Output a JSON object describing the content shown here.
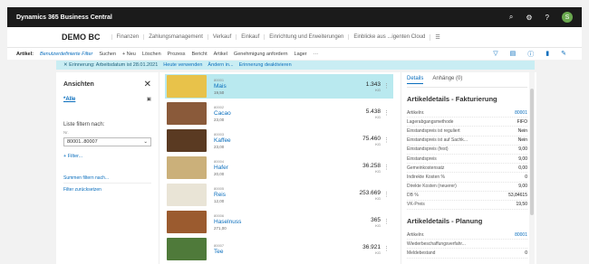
{
  "app": {
    "title": "Dynamics 365 Business Central",
    "icons": [
      "search-icon",
      "gear-icon",
      "help-icon"
    ],
    "avatar_initial": "S"
  },
  "nav": {
    "company": "DEMO BC",
    "items": [
      "Finanzen",
      "Zahlungsmanagement",
      "Verkauf",
      "Einkauf",
      "Einrichtung und Erweiterungen",
      "Einblicke aus ...igenten Cloud"
    ]
  },
  "actions": {
    "label": "Artikel:",
    "filter": "Benutzerdefinierte Filter",
    "items": [
      "Suchen",
      "+ Neu",
      "Löschen",
      "Prozess",
      "Bericht",
      "Artikel",
      "Genehmigung anfordern",
      "Lager",
      "···"
    ]
  },
  "banner": {
    "text": "Erinnerung: Arbeitsdatum ist 28.01.2021",
    "links": [
      "Heute verwenden",
      "Ändern in...",
      "Erinnerung deaktivieren"
    ]
  },
  "filter": {
    "title": "Ansichten",
    "view": "*Alle",
    "list_filter_label": "Liste filtern nach:",
    "field_small": "Nr.",
    "field_value": "80001..80007",
    "add_filter": "+ Filter...",
    "sum_label": "Summen filtern nach...",
    "reset": "Filter zurücksetzen"
  },
  "items": [
    {
      "no": "80001",
      "name": "Mais",
      "price": "19,50",
      "qty": "1.343",
      "unit": "KG",
      "color": "#e8c24a"
    },
    {
      "no": "80002",
      "name": "Cacao",
      "price": "23,00",
      "qty": "5.438",
      "unit": "KG",
      "color": "#8a5a3a"
    },
    {
      "no": "80003",
      "name": "Kaffee",
      "price": "23,00",
      "qty": "75.460",
      "unit": "KG",
      "color": "#5a3a22"
    },
    {
      "no": "80004",
      "name": "Hafer",
      "price": "20,00",
      "qty": "36.258",
      "unit": "KG",
      "color": "#cbb07a"
    },
    {
      "no": "80005",
      "name": "Reis",
      "price": "12,00",
      "qty": "253.669",
      "unit": "KG",
      "color": "#e9e4d6"
    },
    {
      "no": "80006",
      "name": "Haselnuss",
      "price": "271,00",
      "qty": "365",
      "unit": "KG",
      "color": "#9b5b2f"
    },
    {
      "no": "80007",
      "name": "Tee",
      "price": "",
      "qty": "36.921",
      "unit": "KG",
      "color": "#4f7a3a"
    }
  ],
  "details": {
    "tabs": [
      "Details",
      "Anhänge (0)"
    ],
    "section1": "Artikeldetails - Fakturierung",
    "rows1": [
      {
        "k": "Artikelnr.",
        "v": "80001"
      },
      {
        "k": "Lagerabgangsmethode",
        "v": "FIFO"
      },
      {
        "k": "Einstandspreis ist reguliert",
        "v": "Nein"
      },
      {
        "k": "Einstandspreis ist auf Sachk...",
        "v": "Nein"
      },
      {
        "k": "Einstandspreis (fest)",
        "v": "9,00"
      },
      {
        "k": "Einstandspreis",
        "v": "9,00"
      },
      {
        "k": "Gemeinkostensatz",
        "v": "0,00"
      },
      {
        "k": "Indirekte Kosten %",
        "v": "0"
      },
      {
        "k": "Direkte Kosten (neuerer)",
        "v": "9,00"
      },
      {
        "k": "DB %",
        "v": "53,84615"
      },
      {
        "k": "VK-Preis",
        "v": "19,50"
      }
    ],
    "section2": "Artikeldetails - Planung",
    "rows2": [
      {
        "k": "Artikelnr.",
        "v": "80001"
      },
      {
        "k": "Wiederbeschaffungsverfahr...",
        "v": ""
      },
      {
        "k": "Meldebestand",
        "v": "0"
      }
    ]
  }
}
